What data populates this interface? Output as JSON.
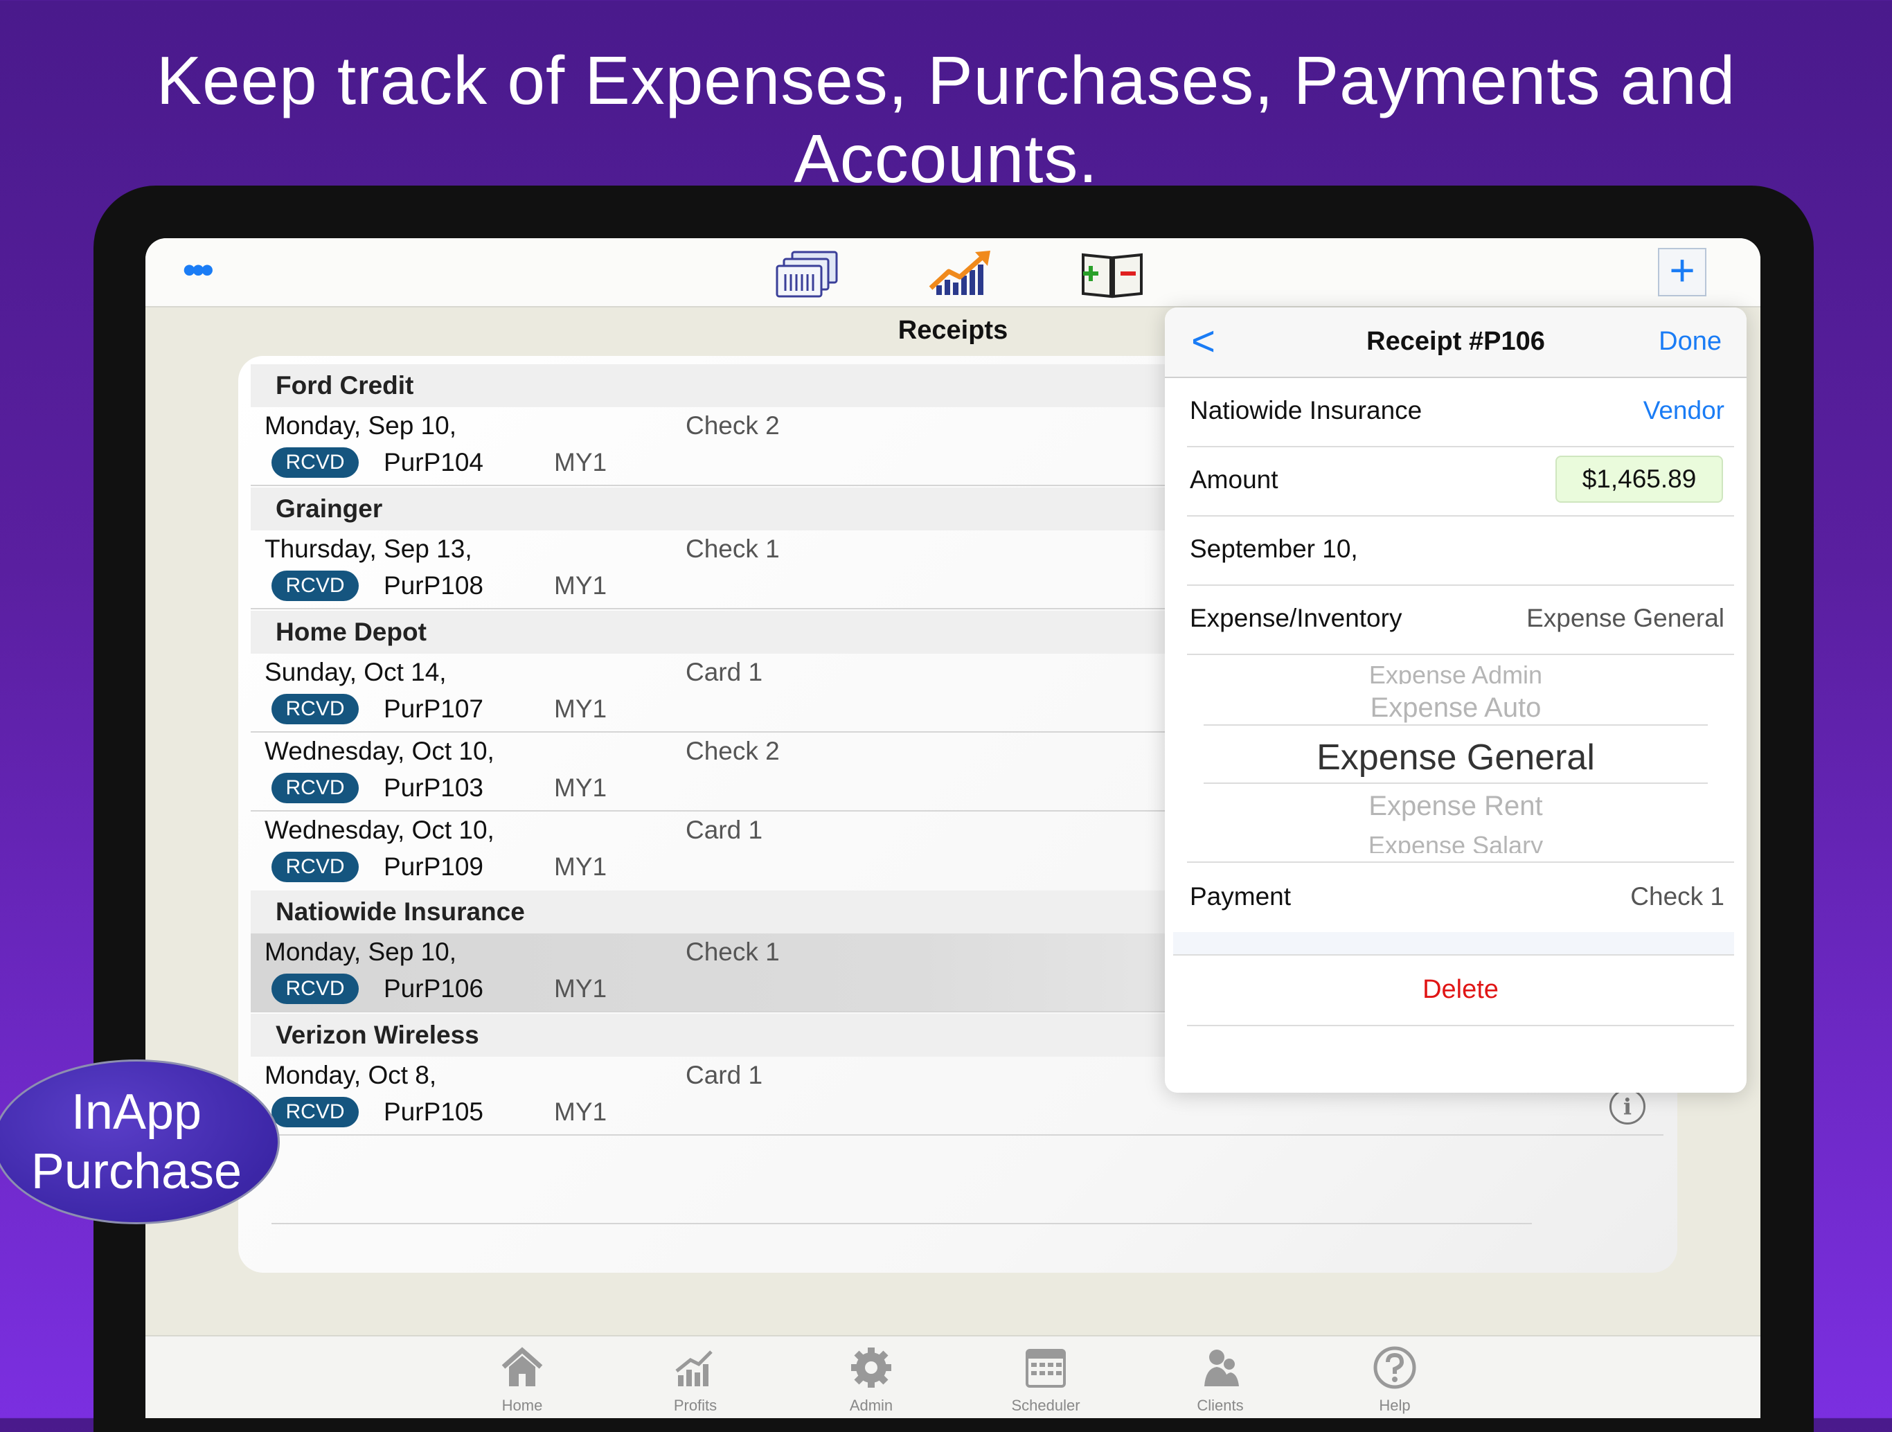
{
  "headline": "Keep track of Expenses, Purchases, Payments and Accounts.",
  "navbar": {
    "menu_dots": "•••",
    "icons": [
      "receipts-icon",
      "profits-chart-icon",
      "ledger-book-icon"
    ],
    "add_label": "+"
  },
  "receipts_title": "Receipts",
  "groups": [
    {
      "name": "Ford Credit",
      "rows": [
        {
          "date": "Monday, Sep 10,",
          "payment": "Check 2",
          "badge": "RCVD",
          "id": "PurP104",
          "tag": "MY1"
        }
      ]
    },
    {
      "name": "Grainger",
      "rows": [
        {
          "date": "Thursday, Sep 13,",
          "payment": "Check 1",
          "badge": "RCVD",
          "id": "PurP108",
          "tag": "MY1"
        }
      ]
    },
    {
      "name": "Home Depot",
      "rows": [
        {
          "date": "Sunday, Oct 14,",
          "payment": "Card 1",
          "badge": "RCVD",
          "id": "PurP107",
          "tag": "MY1"
        },
        {
          "date": "Wednesday, Oct 10,",
          "payment": "Check 2",
          "badge": "RCVD",
          "id": "PurP103",
          "tag": "MY1"
        },
        {
          "date": "Wednesday, Oct 10,",
          "payment": "Card 1",
          "badge": "RCVD",
          "id": "PurP109",
          "tag": "MY1"
        }
      ]
    },
    {
      "name": "Natiowide Insurance",
      "rows": [
        {
          "date": "Monday, Sep 10,",
          "payment": "Check 1",
          "badge": "RCVD",
          "id": "PurP106",
          "tag": "MY1",
          "selected": true
        }
      ]
    },
    {
      "name": "Verizon Wireless",
      "rows": [
        {
          "date": "Monday, Oct 8,",
          "payment": "Card 1",
          "badge": "RCVD",
          "id": "PurP105",
          "tag": "MY1"
        }
      ]
    }
  ],
  "popover": {
    "back": "<",
    "title": "Receipt #P106",
    "done": "Done",
    "vendor_name": "Natiowide Insurance",
    "vendor_label": "Vendor",
    "amount_label": "Amount",
    "amount_value": "$1,465.89",
    "date": "September 10,",
    "expense_label": "Expense/Inventory",
    "expense_value": "Expense General",
    "picker_options": [
      "Expense Admin",
      "Expense Auto",
      "Expense General",
      "Expense Rent",
      "Expense Salary"
    ],
    "payment_label": "Payment",
    "payment_value": "Check 1",
    "delete_label": "Delete"
  },
  "tabs": [
    {
      "label": "Home",
      "icon": "home-icon"
    },
    {
      "label": "Profits",
      "icon": "profits-icon"
    },
    {
      "label": "Admin",
      "icon": "gear-icon"
    },
    {
      "label": "Scheduler",
      "icon": "calendar-icon"
    },
    {
      "label": "Clients",
      "icon": "clients-icon"
    },
    {
      "label": "Help",
      "icon": "help-icon"
    }
  ],
  "inapp": {
    "line1": "InApp",
    "line2": "Purchase"
  },
  "colors": {
    "accent": "#1a7cf5",
    "badge": "#15557f",
    "delete": "#e01515",
    "amount_bg": "#eafbdc"
  }
}
